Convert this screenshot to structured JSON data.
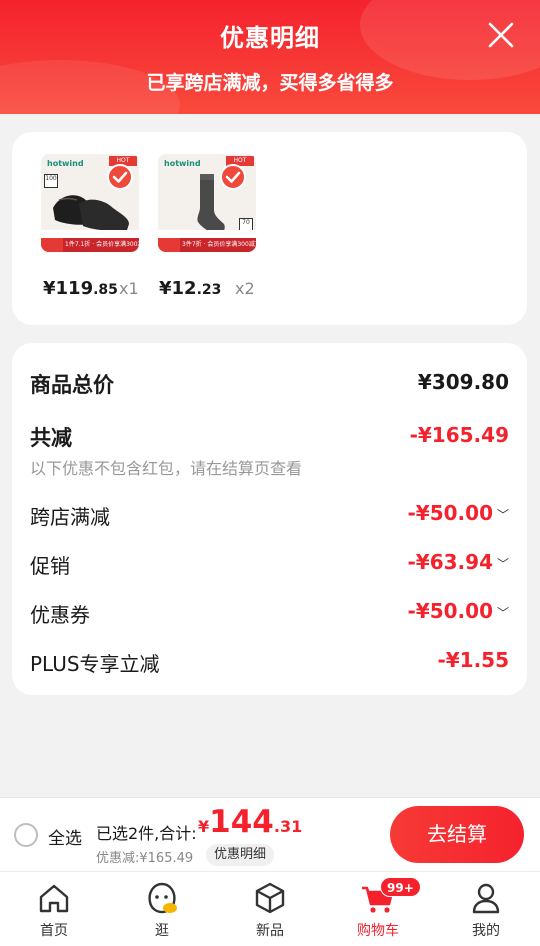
{
  "header": {
    "title": "优惠明细",
    "subtitle": "已享跨店满减，买得多省得多",
    "close_icon": "close-icon"
  },
  "products": [
    {
      "brand": "hotwind",
      "tag": "HOT",
      "badge": "100",
      "promo": "1件7.1折 · 会员价享满300减70",
      "price_int": "¥119",
      "price_dec": ".85",
      "qty": "x1",
      "image_icon": "leather-shoes-image"
    },
    {
      "brand": "hotwind",
      "tag": "HOT",
      "badge": "70",
      "promo": "3件7折 · 会员价享满300减70",
      "price_int": "¥12",
      "price_dec": ".23",
      "qty": "x2",
      "image_icon": "sock-image"
    }
  ],
  "detail": {
    "total_label": "商品总价",
    "total_value": "¥309.80",
    "reduce_label": "共减",
    "reduce_value": "-¥165.49",
    "note": "以下优惠不包含红包，请在结算页查看",
    "items": [
      {
        "label": "跨店满减",
        "value": "-¥50.00",
        "has_chevron": true
      },
      {
        "label": "促销",
        "value": "-¥63.94",
        "has_chevron": true
      },
      {
        "label": "优惠券",
        "value": "-¥50.00",
        "has_chevron": true
      },
      {
        "label": "PLUS专享立减",
        "value": "-¥1.55",
        "has_chevron": false
      }
    ]
  },
  "bottom_bar": {
    "select_all": "全选",
    "selected_text": "已选2件,合计:",
    "total_currency": "¥",
    "total_int": "144",
    "total_dec": ".31",
    "discount_text": "优惠减:¥165.49",
    "detail_chip": "优惠明细",
    "checkout": "去结算"
  },
  "tabbar": {
    "tabs": [
      {
        "label": "首页",
        "icon": "home-icon",
        "active": false
      },
      {
        "label": "逛",
        "icon": "browse-mascot-icon",
        "active": false
      },
      {
        "label": "新品",
        "icon": "cube-icon",
        "active": false
      },
      {
        "label": "购物车",
        "icon": "cart-icon",
        "active": true,
        "badge": "99+"
      },
      {
        "label": "我的",
        "icon": "profile-icon",
        "active": false
      }
    ]
  },
  "colors": {
    "accent": "#f5222d",
    "background": "#f2f2f2",
    "card": "#ffffff"
  }
}
